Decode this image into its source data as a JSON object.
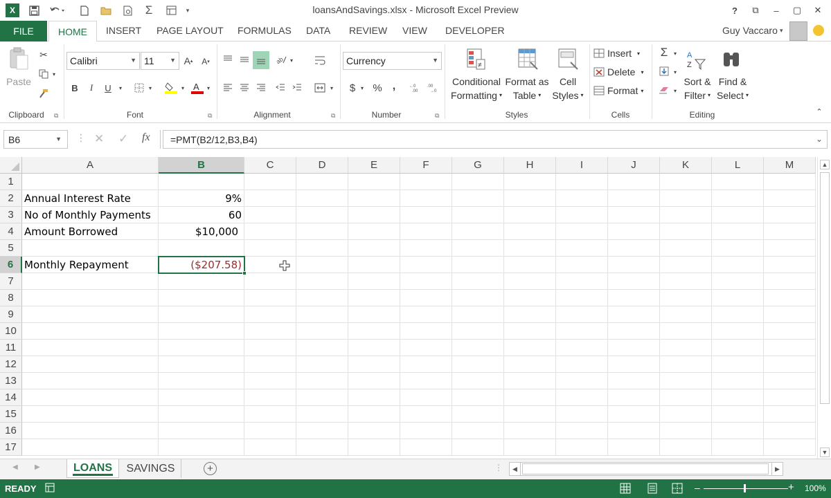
{
  "title_bar": {
    "title": "loansAndSavings.xlsx - Microsoft Excel Preview",
    "app_logo": "X",
    "qat_icons": [
      "save-icon",
      "undo-icon",
      "new-icon",
      "open-icon",
      "print-preview-icon",
      "autosum-icon",
      "form-icon",
      "customize-icon"
    ],
    "help": "?",
    "restore_ribbon": "⧉",
    "minimize": "–",
    "maximize": "▢",
    "close": "✕"
  },
  "tabs": {
    "file": "FILE",
    "items": [
      "HOME",
      "INSERT",
      "PAGE LAYOUT",
      "FORMULAS",
      "DATA",
      "REVIEW",
      "VIEW",
      "DEVELOPER"
    ],
    "active": "HOME"
  },
  "user": {
    "name": "Guy Vaccaro"
  },
  "ribbon": {
    "clipboard": {
      "label": "Clipboard",
      "paste": "Paste"
    },
    "font": {
      "label": "Font",
      "font_name": "Calibri",
      "font_size": "11",
      "bold": "B",
      "italic": "I",
      "underline": "U"
    },
    "alignment": {
      "label": "Alignment"
    },
    "number": {
      "label": "Number",
      "format": "Currency",
      "dollar": "$",
      "percent": "%",
      "comma": ","
    },
    "styles": {
      "label": "Styles",
      "conditional_1": "Conditional",
      "conditional_2": "Formatting",
      "format_table_1": "Format as",
      "format_table_2": "Table",
      "cell_styles_1": "Cell",
      "cell_styles_2": "Styles"
    },
    "cells": {
      "label": "Cells",
      "insert": "Insert",
      "delete": "Delete",
      "format": "Format"
    },
    "editing": {
      "label": "Editing",
      "sort_1": "Sort &",
      "sort_2": "Filter",
      "find_1": "Find &",
      "find_2": "Select"
    }
  },
  "formula_bar": {
    "name_box": "B6",
    "formula": "=PMT(B2/12,B3,B4)",
    "fx": "fx"
  },
  "grid": {
    "columns": [
      "A",
      "B",
      "C",
      "D",
      "E",
      "F",
      "G",
      "H",
      "I",
      "J",
      "K",
      "L",
      "M"
    ],
    "rows": [
      "1",
      "2",
      "3",
      "4",
      "5",
      "6",
      "7",
      "8",
      "9",
      "10",
      "11",
      "12",
      "13",
      "14",
      "15",
      "16",
      "17"
    ],
    "selected_cell": "B6",
    "cells": {
      "A2": "Annual Interest Rate",
      "B2": "9%",
      "A3": "No of Monthly Payments",
      "B3": "60",
      "A4": "Amount Borrowed",
      "B4": "$10,000",
      "A6": "Monthly Repayment",
      "B6": "($207.58)"
    },
    "negative_color": "#9c2b2b"
  },
  "sheets": {
    "tabs": [
      "LOANS",
      "SAVINGS"
    ],
    "active": "LOANS",
    "add": "+"
  },
  "status_bar": {
    "status": "READY",
    "zoom": "100%"
  },
  "colors": {
    "accent": "#217346",
    "header_bg": "#f3f3f3"
  }
}
